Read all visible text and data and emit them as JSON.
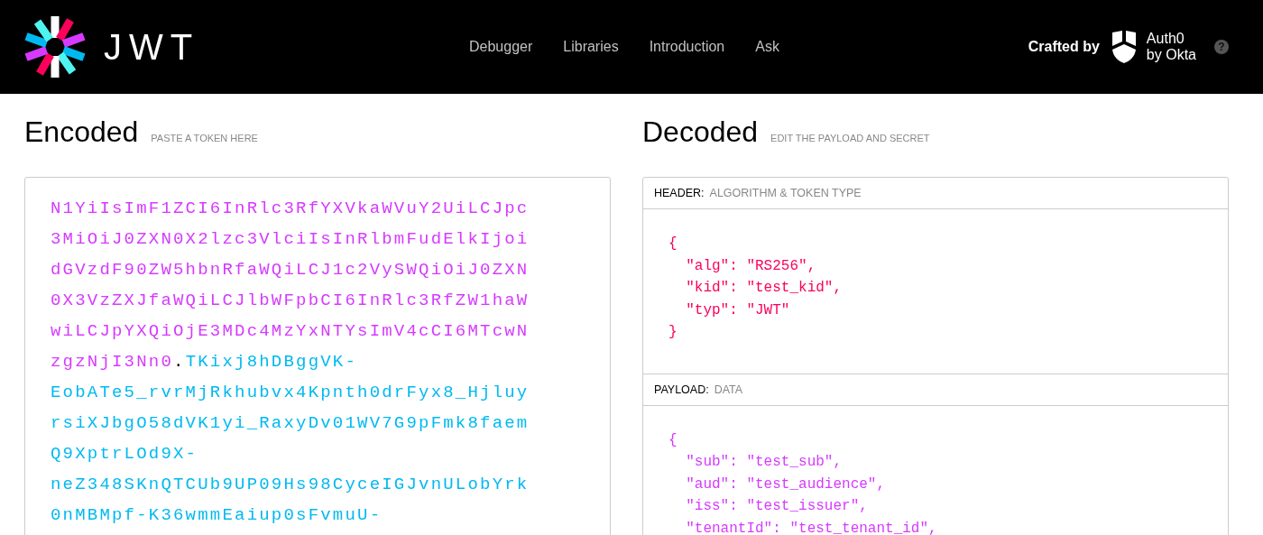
{
  "nav": {
    "logo_text": "JWT",
    "links": [
      "Debugger",
      "Libraries",
      "Introduction",
      "Ask"
    ],
    "crafted_by": "Crafted by",
    "brand_lines": [
      "Auth0",
      "by Okta"
    ],
    "help": "?"
  },
  "encoded": {
    "title": "Encoded",
    "subtitle": "PASTE A TOKEN HERE",
    "lines": [
      [
        {
          "kind": "payload",
          "text": "N1YiIsImF1ZCI6InRlc3RfYXVkaWVuY2UiLCJpc"
        }
      ],
      [
        {
          "kind": "payload",
          "text": "3MiOiJ0ZXN0X2lzc3VlciIsInRlbmFudElkIjoi"
        }
      ],
      [
        {
          "kind": "payload",
          "text": "dGVzdF90ZW5hbnRfaWQiLCJ1c2VySWQiOiJ0ZXN"
        }
      ],
      [
        {
          "kind": "payload",
          "text": "0X3VzZXJfaWQiLCJlbWFpbCI6InRlc3RfZW1haW"
        }
      ],
      [
        {
          "kind": "payload",
          "text": "wiLCJpYXQiOjE3MDc4MzYxNTYsImV4cCI6MTcwN"
        }
      ],
      [
        {
          "kind": "payload",
          "text": "zgzNjI3Nn0"
        },
        {
          "kind": "dot",
          "text": "."
        },
        {
          "kind": "signature",
          "text": "TKixj8hDBggVK-"
        }
      ],
      [
        {
          "kind": "signature",
          "text": "EobATe5_rvrMjRkhubvx4Kpnth0drFyx8_Hjluy"
        }
      ],
      [
        {
          "kind": "signature",
          "text": "rsiXJbgO58dVK1yi_RaxyDv01WV7G9pFmk8faem"
        }
      ],
      [
        {
          "kind": "signature",
          "text": "Q9XptrLOd9X-"
        }
      ],
      [
        {
          "kind": "signature",
          "text": "neZ348SKnQTCUb9UP09Hs98CyceIGJvnULobYrk"
        }
      ],
      [
        {
          "kind": "signature",
          "text": "0nMBMpf-K36wmmEaiup0sFvmuU-"
        }
      ]
    ]
  },
  "decoded": {
    "title": "Decoded",
    "subtitle": "EDIT THE PAYLOAD AND SECRET",
    "sections": [
      {
        "kind": "header",
        "label": "HEADER:",
        "caption": "ALGORITHM & TOKEN TYPE",
        "lines": [
          "{",
          "  \"alg\": \"RS256\",",
          "  \"kid\": \"test_kid\",",
          "  \"typ\": \"JWT\"",
          "}"
        ]
      },
      {
        "kind": "payload",
        "label": "PAYLOAD:",
        "caption": "DATA",
        "lines": [
          "{",
          "  \"sub\": \"test_sub\",",
          "  \"aud\": \"test_audience\",",
          "  \"iss\": \"test_issuer\",",
          "  \"tenantId\": \"test_tenant_id\","
        ]
      }
    ]
  }
}
